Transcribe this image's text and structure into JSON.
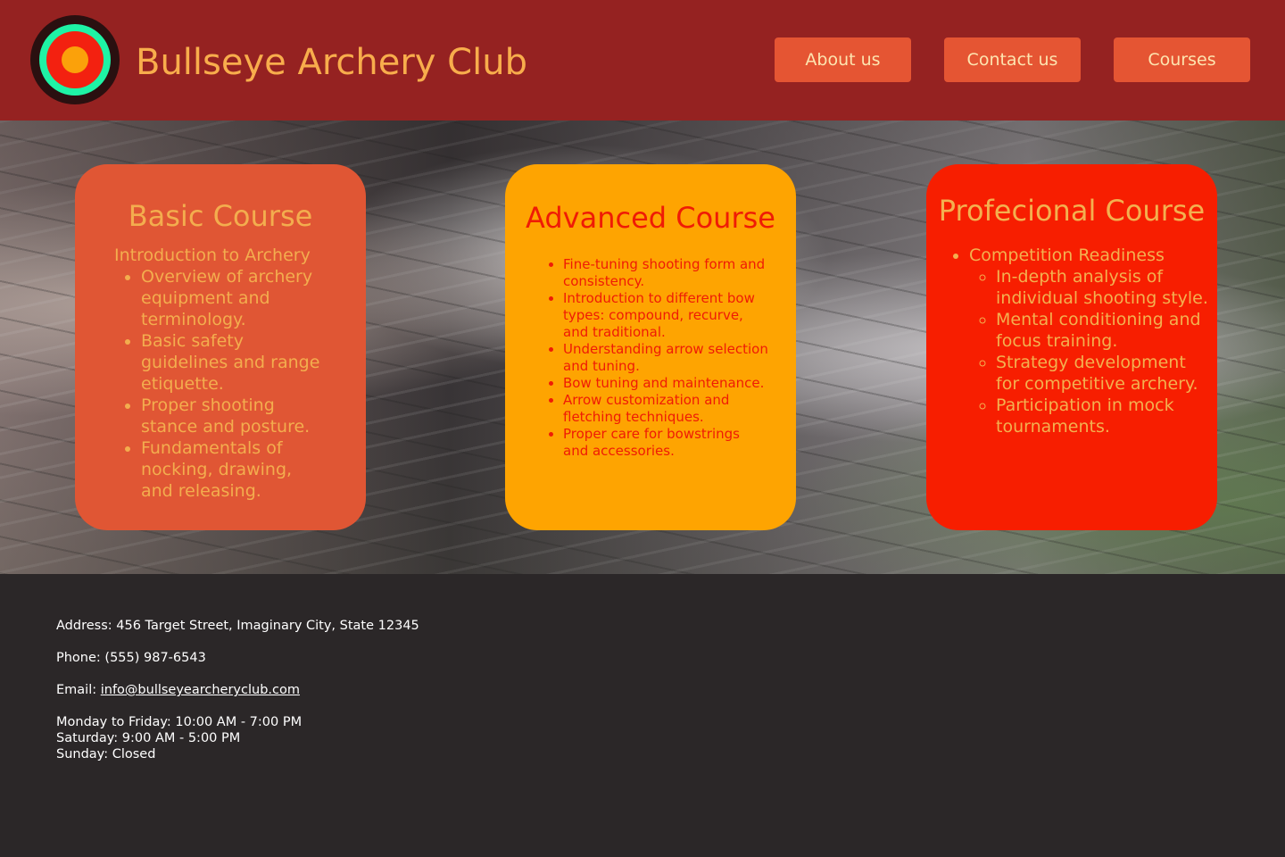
{
  "header": {
    "site_title": "Bullseye Archery Club",
    "logo_icon": "bullseye-target-icon",
    "nav": {
      "about": "About us",
      "contact": "Contact us",
      "courses": "Courses"
    }
  },
  "colors": {
    "header_bg": "#952221",
    "title": "#f8ad4c",
    "nav_button": "#e55533",
    "basic_card": "#e05634",
    "advanced_card": "#fea401",
    "pro_card": "#f71e00",
    "footer_bg": "#2b2728"
  },
  "courses": {
    "basic": {
      "title": "Basic Course",
      "intro": "Introduction to Archery",
      "items": [
        "Overview of archery equipment and terminology.",
        "Basic safety guidelines and range etiquette.",
        "Proper shooting stance and posture.",
        "Fundamentals of nocking, drawing, and releasing."
      ]
    },
    "advanced": {
      "title": "Advanced Course",
      "items": [
        "Fine-tuning shooting form and consistency.",
        "Introduction to different bow types: compound, recurve, and traditional.",
        "Understanding arrow selection and tuning.",
        "Bow tuning and maintenance.",
        "Arrow customization and fletching techniques.",
        "Proper care for bowstrings and accessories."
      ]
    },
    "pro": {
      "title": "Profecional Course",
      "heading_item": "Competition Readiness",
      "items": [
        "In-depth analysis of individual shooting style.",
        "Mental conditioning and focus training.",
        "Strategy development for competitive archery.",
        "Participation in mock tournaments."
      ]
    }
  },
  "footer": {
    "address": "Address: 456 Target Street, Imaginary City, State 12345",
    "phone": "Phone: (555) 987-6543",
    "email_label": "Email:",
    "email": "info@bullseyearcheryclub.com",
    "hours": [
      "Monday to Friday: 10:00 AM - 7:00 PM",
      "Saturday: 9:00 AM - 5:00 PM",
      "Sunday: Closed"
    ]
  }
}
